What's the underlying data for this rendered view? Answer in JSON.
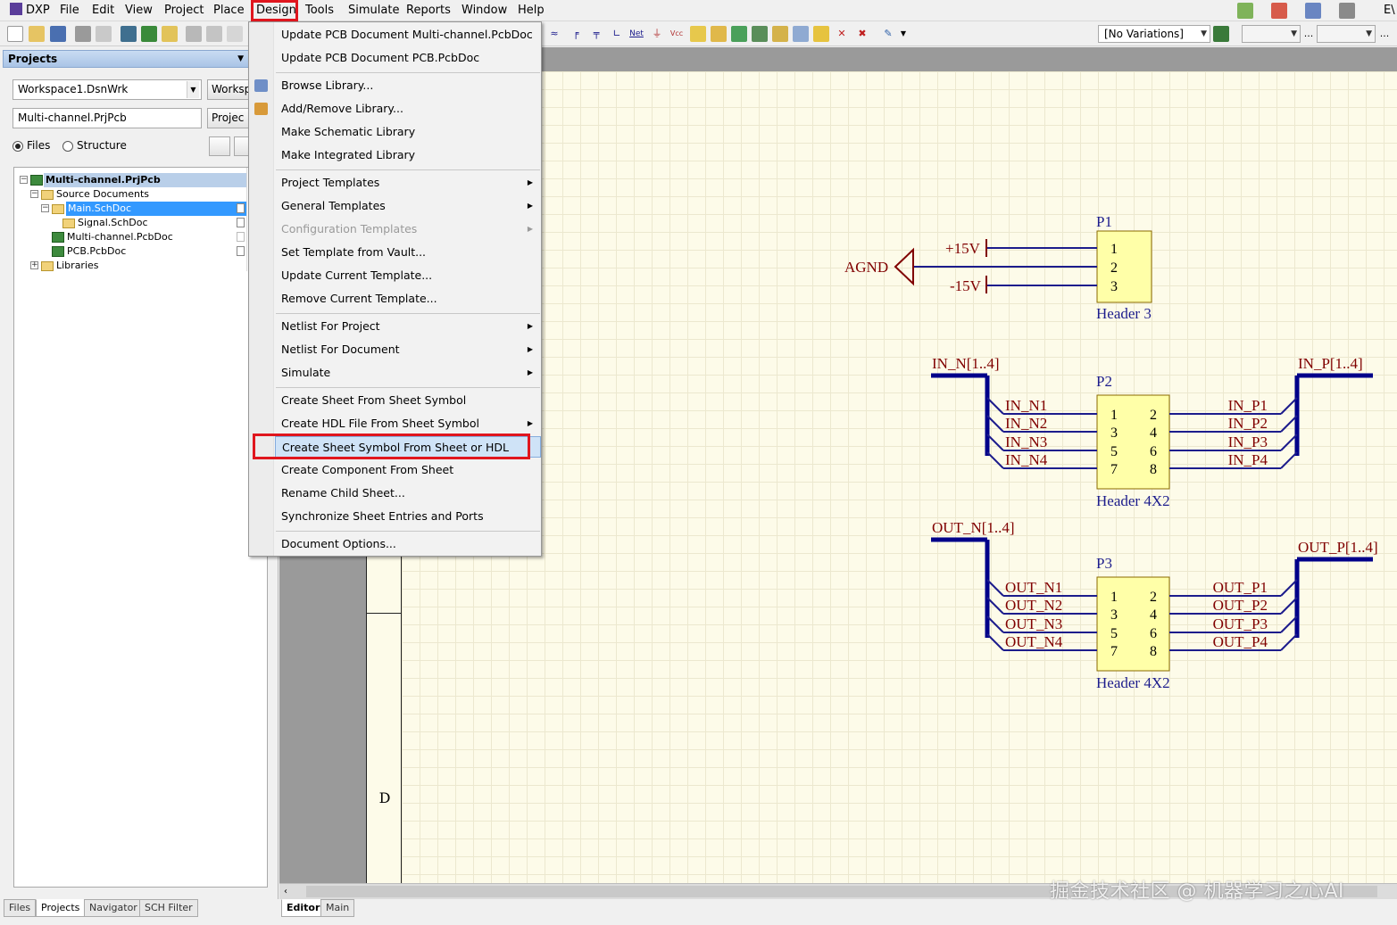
{
  "menubar": {
    "items": [
      "DXP",
      "File",
      "Edit",
      "View",
      "Project",
      "Place",
      "Design",
      "Tools",
      "Simulate",
      "Reports",
      "Window",
      "Help"
    ],
    "active": "Design",
    "right_clipped": "E\\"
  },
  "toolbar": {
    "variations": "[No Variations]",
    "net_icon_text": "Net",
    "vcc_icon_text": "Vcc",
    "ellipsis": "..."
  },
  "projects_panel": {
    "title": "Projects",
    "workspace_value": "Workspace1.DsnWrk",
    "workspace_button": "Worksp",
    "project_value": "Multi-channel.PrjPcb",
    "project_button": "Projec",
    "radio_files": "Files",
    "radio_structure": "Structure",
    "selected_radio": "Files",
    "tree": [
      {
        "label": "Multi-channel.PrjPcb",
        "level": 0,
        "type": "project",
        "expander": "−",
        "selected": "project"
      },
      {
        "label": "Source Documents",
        "level": 1,
        "type": "folder",
        "expander": "−"
      },
      {
        "label": "Main.SchDoc",
        "level": 2,
        "type": "folder",
        "expander": "−",
        "selected": "focus"
      },
      {
        "label": "Signal.SchDoc",
        "level": 3,
        "type": "folder"
      },
      {
        "label": "Multi-channel.PcbDoc",
        "level": 2,
        "type": "pcb"
      },
      {
        "label": "PCB.PcbDoc",
        "level": 2,
        "type": "pcb"
      },
      {
        "label": "Libraries",
        "level": 1,
        "type": "folder",
        "expander": "+"
      }
    ]
  },
  "left_tabs": [
    "Files",
    "Projects",
    "Navigator",
    "SCH Filter"
  ],
  "left_tab_active": "Projects",
  "right_tabs": [
    "Editor",
    "Main"
  ],
  "right_tab_active": "Editor",
  "design_menu": {
    "items": [
      {
        "label": "Update PCB Document Multi-channel.PcbDoc"
      },
      {
        "label": "Update PCB Document PCB.PcbDoc"
      },
      {
        "sep": true
      },
      {
        "label": "Browse Library...",
        "icon": "browse-library-icon"
      },
      {
        "label": "Add/Remove Library...",
        "icon": "library-book-icon"
      },
      {
        "label": "Make Schematic Library"
      },
      {
        "label": "Make Integrated Library"
      },
      {
        "sep": true
      },
      {
        "label": "Project Templates",
        "submenu": true
      },
      {
        "label": "General Templates",
        "submenu": true
      },
      {
        "label": "Configuration Templates",
        "submenu": true,
        "disabled": true
      },
      {
        "label": "Set Template from Vault..."
      },
      {
        "label": "Update Current Template..."
      },
      {
        "label": "Remove Current Template..."
      },
      {
        "sep": true
      },
      {
        "label": "Netlist For Project",
        "submenu": true
      },
      {
        "label": "Netlist For Document",
        "submenu": true
      },
      {
        "label": "Simulate",
        "submenu": true
      },
      {
        "sep": true
      },
      {
        "label": "Create Sheet From Sheet Symbol"
      },
      {
        "label": "Create HDL File From Sheet Symbol",
        "submenu": true
      },
      {
        "label": "Create Sheet Symbol From Sheet or HDL",
        "selected": true
      },
      {
        "label": "Create Component From Sheet"
      },
      {
        "label": "Rename Child Sheet..."
      },
      {
        "label": "Synchronize Sheet Entries and Ports"
      },
      {
        "sep": true
      },
      {
        "label": "Document Options..."
      }
    ]
  },
  "schematic": {
    "border_zone_letter": "D",
    "p1": {
      "designator": "P1",
      "comment": "Header 3",
      "pins": [
        "1",
        "2",
        "3"
      ],
      "plus": "+15V",
      "minus": "-15V",
      "gnd": "AGND"
    },
    "p2": {
      "designator": "P2",
      "comment": "Header 4X2",
      "left_pins": [
        "1",
        "3",
        "5",
        "7"
      ],
      "right_pins": [
        "2",
        "4",
        "6",
        "8"
      ],
      "left_bus": "IN_N[1..4]",
      "right_bus": "IN_P[1..4]",
      "left_nets": [
        "IN_N1",
        "IN_N2",
        "IN_N3",
        "IN_N4"
      ],
      "right_nets": [
        "IN_P1",
        "IN_P2",
        "IN_P3",
        "IN_P4"
      ]
    },
    "p3": {
      "designator": "P3",
      "comment": "Header 4X2",
      "left_pins": [
        "1",
        "3",
        "5",
        "7"
      ],
      "right_pins": [
        "2",
        "4",
        "6",
        "8"
      ],
      "left_bus": "OUT_N[1..4]",
      "right_bus": "OUT_P[1..4]",
      "left_nets": [
        "OUT_N1",
        "OUT_N2",
        "OUT_N3",
        "OUT_N4"
      ],
      "right_nets": [
        "OUT_P1",
        "OUT_P2",
        "OUT_P3",
        "OUT_P4"
      ]
    },
    "colors": {
      "wire": "#1c1c8c",
      "label": "#800000",
      "designator": "#1c1c8c",
      "body": "#ffffa8",
      "bus": "#00008a"
    }
  },
  "watermark": "掘金技术社区 @ 机器学习之心AI",
  "colors": {
    "accent_red": "#e0161e",
    "selection_blue": "#3399ff",
    "panel_header": "#b9cfe9"
  }
}
